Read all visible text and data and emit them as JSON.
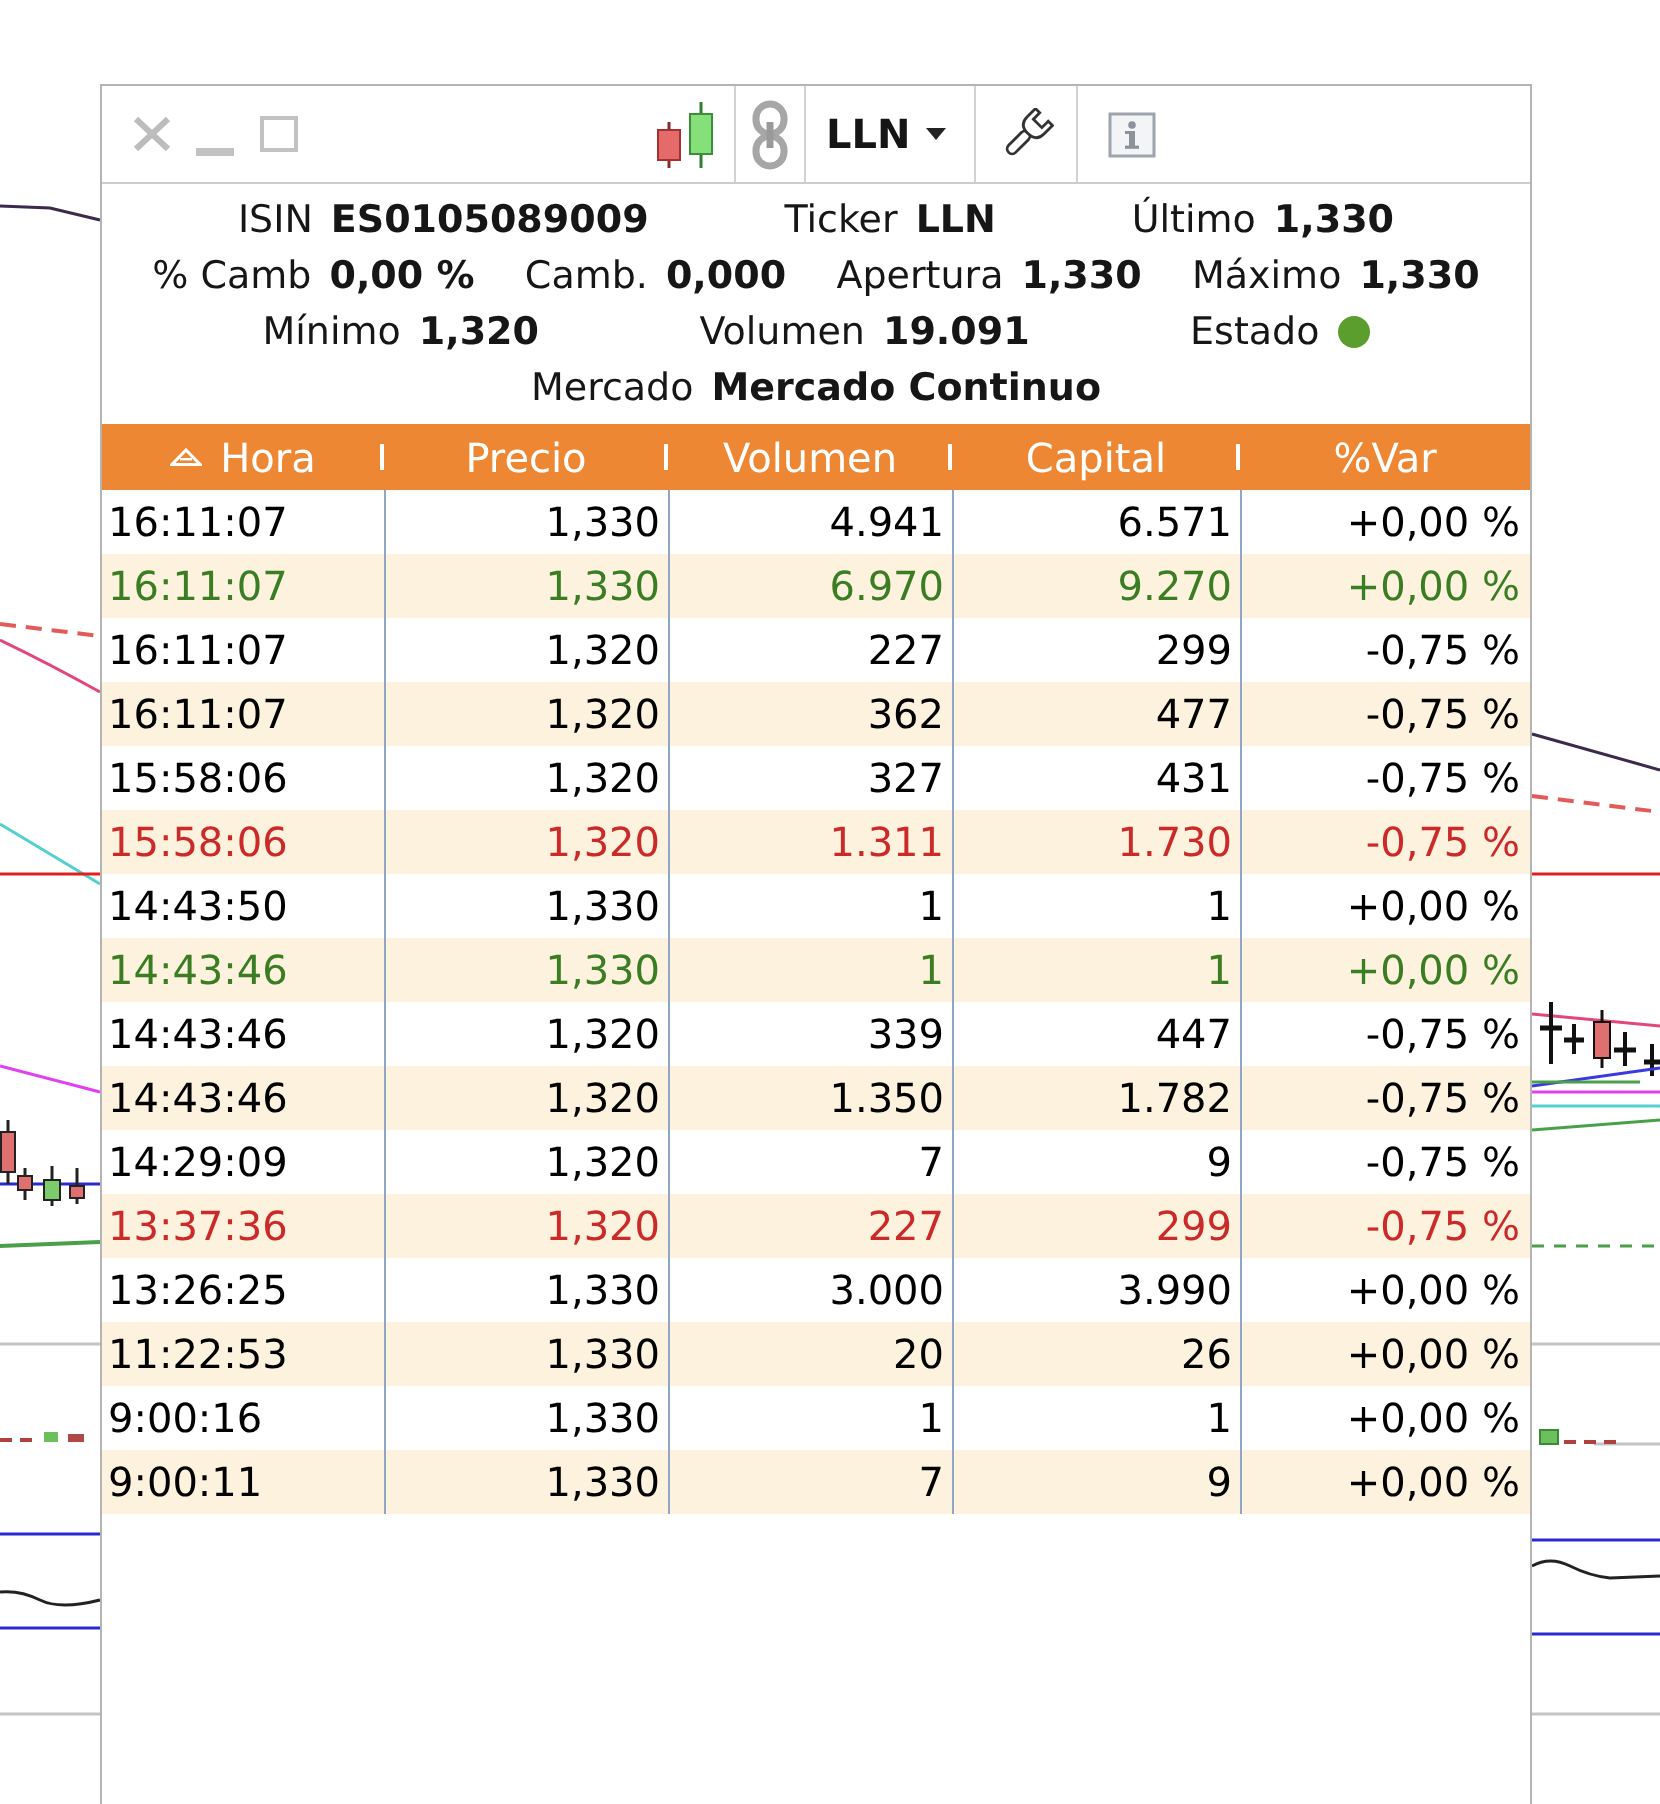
{
  "toolbar": {
    "symbol": "LLN"
  },
  "quote": {
    "lines": [
      {
        "items": [
          {
            "label": "ISIN",
            "value": "ES0105089009"
          },
          {
            "label": "Ticker",
            "value": "LLN"
          },
          {
            "label": "Último",
            "value": "1,330"
          }
        ]
      },
      {
        "items": [
          {
            "label": "% Camb",
            "value": "0,00 %"
          },
          {
            "label": "Camb.",
            "value": "0,000"
          },
          {
            "label": "Apertura",
            "value": "1,330"
          },
          {
            "label": "Máximo",
            "value": "1,330"
          }
        ]
      },
      {
        "items": [
          {
            "label": "Mínimo",
            "value": "1,320"
          },
          {
            "label": "Volumen",
            "value": "19.091"
          },
          {
            "label": "Estado",
            "color": "#5b9e2e"
          }
        ]
      },
      {
        "items": [
          {
            "label": "Mercado",
            "value": "Mercado Continuo"
          }
        ]
      }
    ]
  },
  "table": {
    "columns": [
      {
        "label": "Hora",
        "sorted": true
      },
      {
        "label": "Precio",
        "sorted": false
      },
      {
        "label": "Volumen",
        "sorted": false
      },
      {
        "label": "Capital",
        "sorted": false
      },
      {
        "label": "%Var",
        "sorted": false
      }
    ],
    "rows": [
      {
        "color": "#000000",
        "cells": [
          "16:11:07",
          "1,330",
          "4.941",
          "6.571",
          "+0,00 %"
        ]
      },
      {
        "color": "#3a7d22",
        "cells": [
          "16:11:07",
          "1,330",
          "6.970",
          "9.270",
          "+0,00 %"
        ]
      },
      {
        "color": "#000000",
        "cells": [
          "16:11:07",
          "1,320",
          "227",
          "299",
          "-0,75 %"
        ]
      },
      {
        "color": "#000000",
        "cells": [
          "16:11:07",
          "1,320",
          "362",
          "477",
          "-0,75 %"
        ]
      },
      {
        "color": "#000000",
        "cells": [
          "15:58:06",
          "1,320",
          "327",
          "431",
          "-0,75 %"
        ]
      },
      {
        "color": "#cc2929",
        "cells": [
          "15:58:06",
          "1,320",
          "1.311",
          "1.730",
          "-0,75 %"
        ]
      },
      {
        "color": "#000000",
        "cells": [
          "14:43:50",
          "1,330",
          "1",
          "1",
          "+0,00 %"
        ]
      },
      {
        "color": "#3a7d22",
        "cells": [
          "14:43:46",
          "1,330",
          "1",
          "1",
          "+0,00 %"
        ]
      },
      {
        "color": "#000000",
        "cells": [
          "14:43:46",
          "1,320",
          "339",
          "447",
          "-0,75 %"
        ]
      },
      {
        "color": "#000000",
        "cells": [
          "14:43:46",
          "1,320",
          "1.350",
          "1.782",
          "-0,75 %"
        ]
      },
      {
        "color": "#000000",
        "cells": [
          "14:29:09",
          "1,320",
          "7",
          "9",
          "-0,75 %"
        ]
      },
      {
        "color": "#cc2929",
        "cells": [
          "13:37:36",
          "1,320",
          "227",
          "299",
          "-0,75 %"
        ]
      },
      {
        "color": "#000000",
        "cells": [
          "13:26:25",
          "1,330",
          "3.000",
          "3.990",
          "+0,00 %"
        ]
      },
      {
        "color": "#000000",
        "cells": [
          "11:22:53",
          "1,330",
          "20",
          "26",
          "+0,00 %"
        ]
      },
      {
        "color": "#000000",
        "cells": [
          "9:00:16",
          "1,330",
          "1",
          "1",
          "+0,00 %"
        ]
      },
      {
        "color": "#000000",
        "cells": [
          "9:00:11",
          "1,330",
          "7",
          "9",
          "+0,00 %"
        ]
      }
    ]
  }
}
